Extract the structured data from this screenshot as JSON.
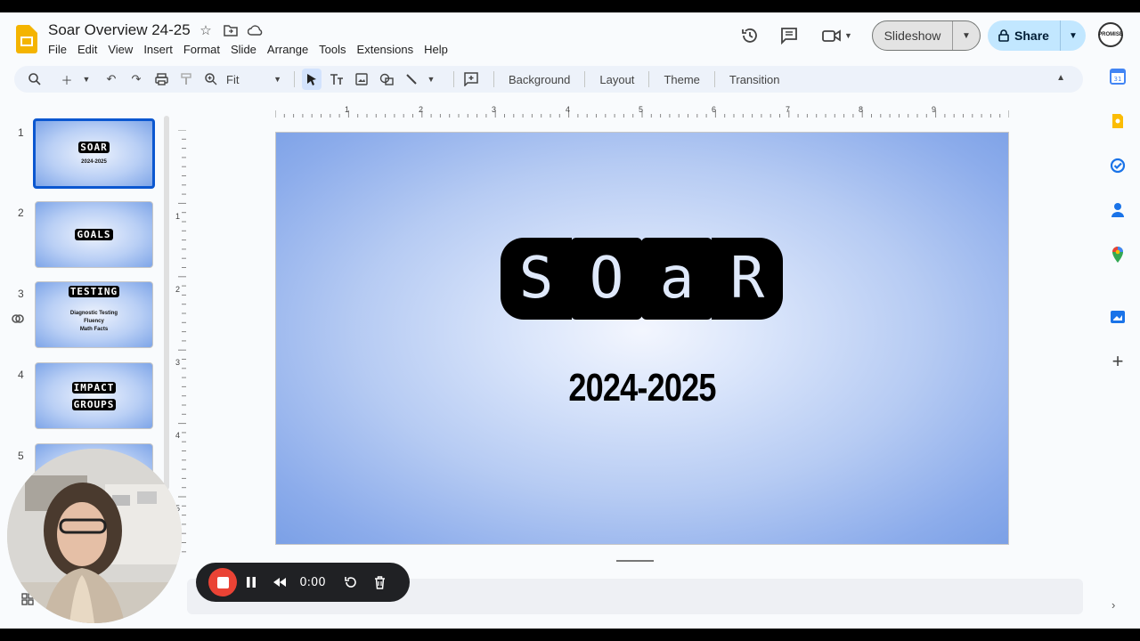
{
  "app": {
    "title": "Soar Overview 24-25",
    "menu": [
      "File",
      "Edit",
      "View",
      "Insert",
      "Format",
      "Slide",
      "Arrange",
      "Tools",
      "Extensions",
      "Help"
    ]
  },
  "header": {
    "slideshow_label": "Slideshow",
    "share_label": "Share",
    "avatar_text": "PROMISE"
  },
  "toolbar": {
    "zoom_value": "Fit",
    "background_label": "Background",
    "layout_label": "Layout",
    "theme_label": "Theme",
    "transition_label": "Transition"
  },
  "filmstrip": {
    "slides": [
      {
        "num": "1",
        "title": "SOAR",
        "sub": "2024-2025"
      },
      {
        "num": "2",
        "title": "GOALS",
        "sub": ""
      },
      {
        "num": "3",
        "title": "TESTING",
        "sub": "Diagnostic Testing\nFluency\nMath Facts"
      },
      {
        "num": "4",
        "title": "IMPACT",
        "title2": "GROUPS",
        "sub": ""
      },
      {
        "num": "5",
        "title": "",
        "sub": ""
      }
    ]
  },
  "rulers": {
    "horizontal": [
      "1",
      "2",
      "3",
      "4",
      "5",
      "6",
      "7",
      "8",
      "9"
    ],
    "vertical": [
      "1",
      "2",
      "3",
      "4",
      "5"
    ]
  },
  "slide": {
    "title_letters": [
      "S",
      "O",
      "a",
      "R"
    ],
    "subtitle": "2024-2025"
  },
  "recorder": {
    "time": "0:00"
  },
  "colors": {
    "accent": "#0b57d0",
    "share_bg": "#c2e7ff",
    "record_red": "#ea4335"
  }
}
